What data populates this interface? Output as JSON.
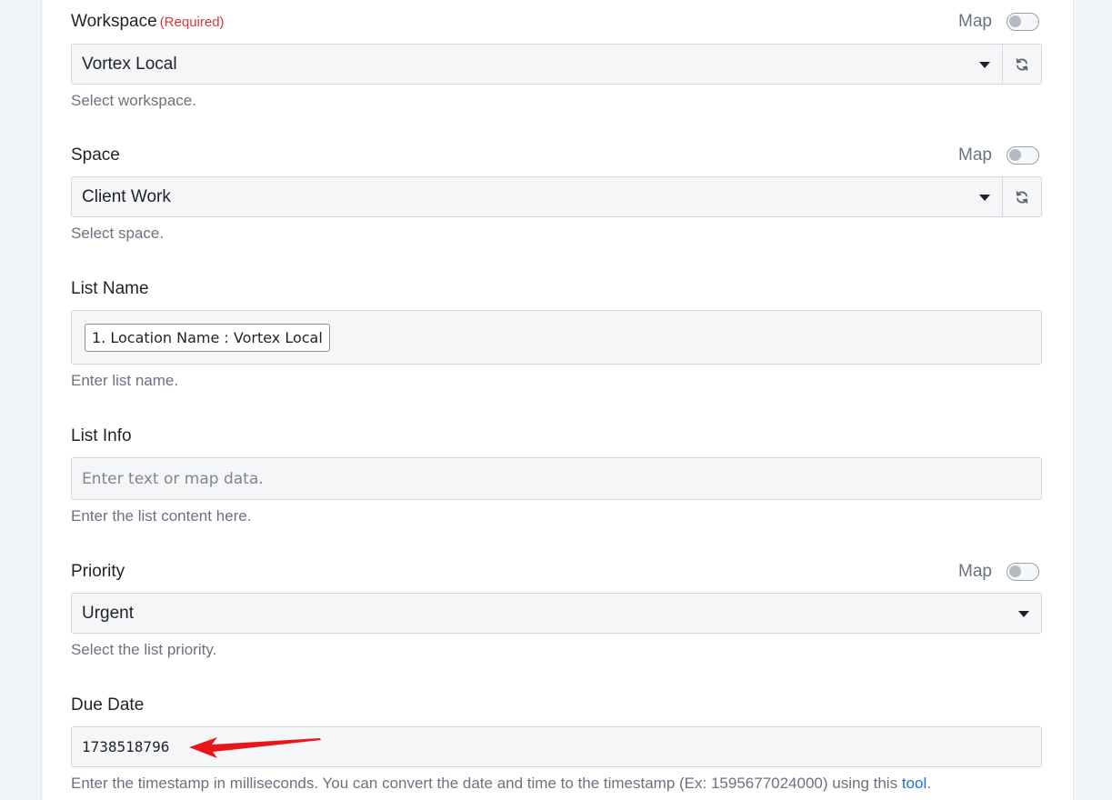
{
  "workspace": {
    "label": "Workspace",
    "required": "(Required)",
    "map": "Map",
    "value": "Vortex Local",
    "hint": "Select workspace."
  },
  "space": {
    "label": "Space",
    "map": "Map",
    "value": "Client Work",
    "hint": "Select space."
  },
  "list_name": {
    "label": "List Name",
    "chip": "1. Location Name : Vortex Local",
    "hint": "Enter list name."
  },
  "list_info": {
    "label": "List Info",
    "placeholder": "Enter text or map data.",
    "hint": "Enter the list content here."
  },
  "priority": {
    "label": "Priority",
    "map": "Map",
    "value": "Urgent",
    "hint": "Select the list priority."
  },
  "due_date": {
    "label": "Due Date",
    "value": "1738518796",
    "hint": "Enter the timestamp in milliseconds. You can convert the date and time to the timestamp (Ex: 1595677024000) using this ",
    "hint_link": "tool",
    "hint_end": "."
  },
  "colors": {
    "required": "#d9363e",
    "link": "#1a73c9",
    "annotation_arrow": "#e8161b"
  },
  "icons": {
    "refresh": "refresh-icon",
    "dropdown": "caret-down-icon",
    "arrow": "red-arrow-annotation"
  }
}
